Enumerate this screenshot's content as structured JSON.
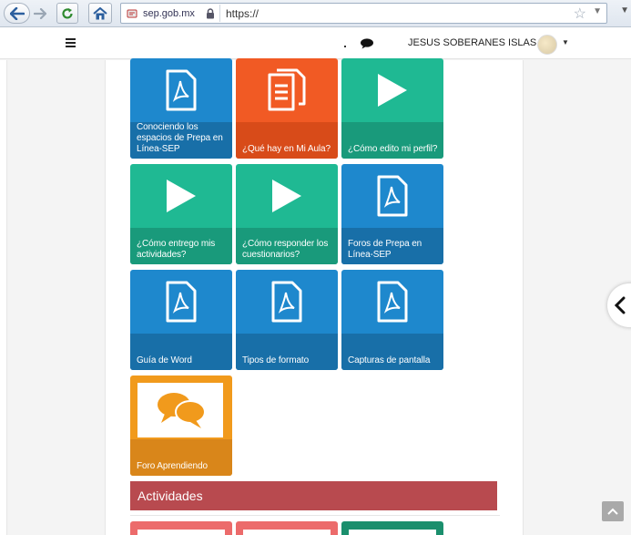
{
  "browser": {
    "domain": "sep.gob.mx",
    "url": "https://",
    "icons": [
      "back-icon",
      "forward-icon",
      "reload-icon",
      "home-icon",
      "lock-icon",
      "star-icon"
    ]
  },
  "navbar": {
    "user_name": "JESUS SOBERANES ISLAS",
    "icons": [
      "hamburger-icon",
      "chat-icon",
      "avatar",
      "caret-down-icon"
    ]
  },
  "tiles": [
    {
      "label": "Conociendo los espacios de Prepa en Línea-SEP",
      "icon": "pdf-icon",
      "color": "#1e88cd"
    },
    {
      "label": "¿Qué hay en Mi Aula?",
      "icon": "documents-icon",
      "color": "#f15a24"
    },
    {
      "label": "¿Cómo edito mi perfil?",
      "icon": "play-icon",
      "color": "#1fb993"
    },
    {
      "label": "¿Cómo entrego mis actividades?",
      "icon": "play-icon",
      "color": "#1fb993"
    },
    {
      "label": "¿Cómo responder los cuestionarios?",
      "icon": "play-icon",
      "color": "#1fb993"
    },
    {
      "label": "Foros de Prepa en Línea-SEP",
      "icon": "pdf-icon",
      "color": "#1e88cd"
    },
    {
      "label": "Guía de Word",
      "icon": "pdf-icon",
      "color": "#1e88cd"
    },
    {
      "label": "Tipos de formato",
      "icon": "pdf-icon",
      "color": "#1e88cd"
    },
    {
      "label": "Capturas de pantalla",
      "icon": "pdf-icon",
      "color": "#1e88cd"
    },
    {
      "label": "Foro Aprendiendo",
      "icon": "speech-bubbles-icon",
      "color": "#f19a1c"
    }
  ],
  "section": {
    "title": "Actividades",
    "color": "#b84a4f"
  },
  "colors": {
    "pdf_blue": "#1e88cd",
    "orange": "#f15a24",
    "teal": "#1fb993",
    "amber": "#f19a1c",
    "peek_red": "#ec6b6b",
    "peek_green": "#1b8f6d"
  }
}
